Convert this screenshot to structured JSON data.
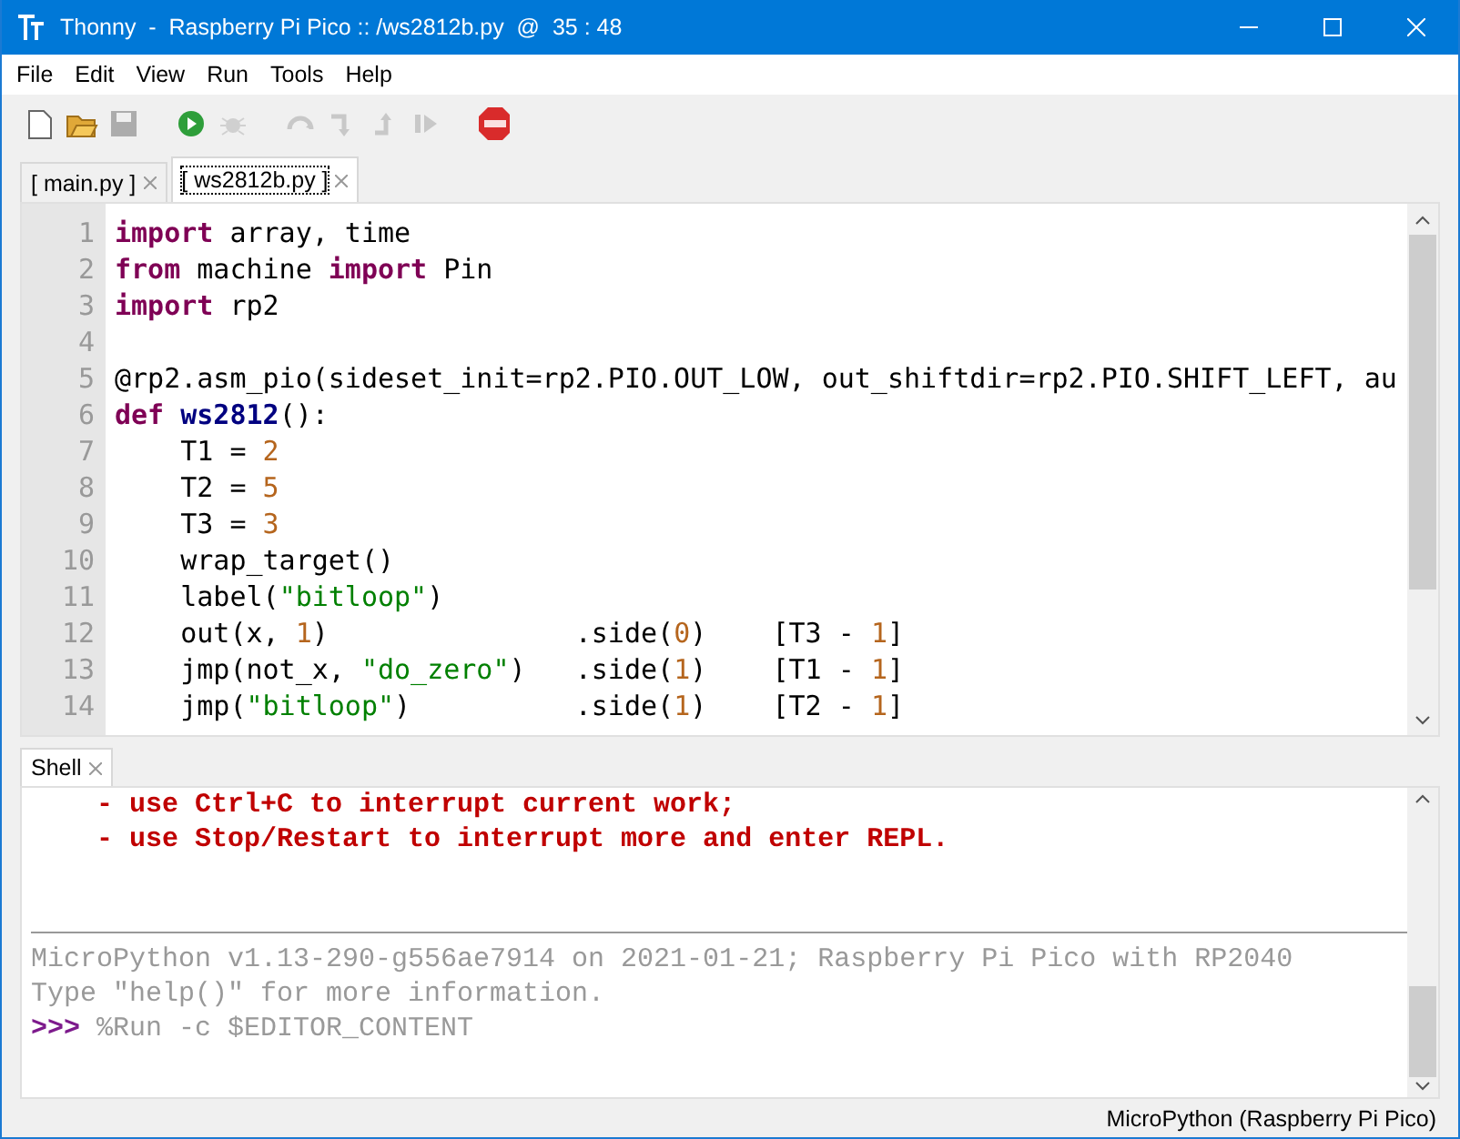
{
  "window": {
    "title": "Thonny  -  Raspberry Pi Pico :: /ws2812b.py  @  35 : 48"
  },
  "menu": [
    "File",
    "Edit",
    "View",
    "Run",
    "Tools",
    "Help"
  ],
  "toolbar": [
    {
      "kind": "new",
      "disabled": false
    },
    {
      "kind": "open",
      "disabled": false
    },
    {
      "kind": "save",
      "disabled": true
    },
    {
      "kind": "run",
      "disabled": false
    },
    {
      "kind": "debug",
      "disabled": true
    },
    {
      "kind": "step_over",
      "disabled": true
    },
    {
      "kind": "step_into",
      "disabled": true
    },
    {
      "kind": "step_out",
      "disabled": true
    },
    {
      "kind": "resume",
      "disabled": true
    },
    {
      "kind": "stop",
      "disabled": false
    }
  ],
  "editor_tabs": [
    {
      "label": "[ main.py ]",
      "selected": false
    },
    {
      "label": "[ ws2812b.py ]",
      "selected": true
    }
  ],
  "editor": {
    "lines": [
      {
        "number": "1",
        "tokens": [
          {
            "kind": "keyword",
            "text": "import"
          },
          {
            "kind": "plain",
            "text": " array, time"
          }
        ]
      },
      {
        "number": "2",
        "tokens": [
          {
            "kind": "keyword",
            "text": "from"
          },
          {
            "kind": "plain",
            "text": " machine "
          },
          {
            "kind": "keyword",
            "text": "import"
          },
          {
            "kind": "plain",
            "text": " Pin"
          }
        ]
      },
      {
        "number": "3",
        "tokens": [
          {
            "kind": "keyword",
            "text": "import"
          },
          {
            "kind": "plain",
            "text": " rp2"
          }
        ]
      },
      {
        "number": "4"
      },
      {
        "number": "5",
        "tokens": [
          {
            "kind": "plain",
            "text": "@rp2.asm_pio(sideset_init=rp2.PIO.OUT_LOW, out_shiftdir=rp2.PIO.SHIFT_LEFT, au"
          }
        ]
      },
      {
        "number": "6",
        "tokens": [
          {
            "kind": "keyword",
            "text": "def "
          },
          {
            "kind": "name",
            "text": "ws2812"
          },
          {
            "kind": "plain",
            "text": "():"
          }
        ]
      },
      {
        "number": "7",
        "tokens": [
          {
            "kind": "plain",
            "text": "    T1 = "
          },
          {
            "kind": "number",
            "text": "2"
          }
        ]
      },
      {
        "number": "8",
        "tokens": [
          {
            "kind": "plain",
            "text": "    T2 = "
          },
          {
            "kind": "number",
            "text": "5"
          }
        ]
      },
      {
        "number": "9",
        "tokens": [
          {
            "kind": "plain",
            "text": "    T3 = "
          },
          {
            "kind": "number",
            "text": "3"
          }
        ]
      },
      {
        "number": "10",
        "tokens": [
          {
            "kind": "plain",
            "text": "    wrap_target()"
          }
        ]
      },
      {
        "number": "11",
        "tokens": [
          {
            "kind": "plain",
            "text": "    label("
          },
          {
            "kind": "string",
            "text": "\"bitloop\""
          },
          {
            "kind": "plain",
            "text": ")"
          }
        ]
      },
      {
        "number": "12",
        "tokens": [
          {
            "kind": "plain",
            "text": "    out(x, "
          },
          {
            "kind": "number",
            "text": "1"
          },
          {
            "kind": "plain",
            "text": ")               .side("
          },
          {
            "kind": "number",
            "text": "0"
          },
          {
            "kind": "plain",
            "text": ")    [T3 - "
          },
          {
            "kind": "number",
            "text": "1"
          },
          {
            "kind": "plain",
            "text": "]"
          }
        ]
      },
      {
        "number": "13",
        "tokens": [
          {
            "kind": "plain",
            "text": "    jmp(not_x, "
          },
          {
            "kind": "string",
            "text": "\"do_zero\""
          },
          {
            "kind": "plain",
            "text": ")   .side("
          },
          {
            "kind": "number",
            "text": "1"
          },
          {
            "kind": "plain",
            "text": ")    [T1 - "
          },
          {
            "kind": "number",
            "text": "1"
          },
          {
            "kind": "plain",
            "text": "]"
          }
        ]
      },
      {
        "number": "14",
        "tokens": [
          {
            "kind": "plain",
            "text": "    jmp("
          },
          {
            "kind": "string",
            "text": "\"bitloop\""
          },
          {
            "kind": "plain",
            "text": ")          .side("
          },
          {
            "kind": "number",
            "text": "1"
          },
          {
            "kind": "plain",
            "text": ")    [T2 - "
          },
          {
            "kind": "number",
            "text": "1"
          },
          {
            "kind": "plain",
            "text": "]"
          }
        ]
      }
    ]
  },
  "shell_tabs": [
    {
      "label": "Shell",
      "selected": true
    }
  ],
  "shell": {
    "lines": [
      {
        "kind": "error",
        "text": "    - use Ctrl+C to interrupt current work;"
      },
      {
        "kind": "error",
        "text": "    - use Stop/Restart to interrupt more and enter REPL."
      },
      {
        "kind": "blank"
      },
      {
        "kind": "blank"
      },
      {
        "kind": "separator"
      },
      {
        "kind": "info",
        "text": "MicroPython v1.13-290-g556ae7914 on 2021-01-21; Raspberry Pi Pico with RP2040"
      },
      {
        "kind": "info",
        "text": "Type \"help()\" for more information."
      },
      {
        "kind": "prompt",
        "prompt": ">>>",
        "text": " %Run -c $EDITOR_CONTENT"
      }
    ]
  },
  "status_bar": "MicroPython (Raspberry Pi Pico)"
}
